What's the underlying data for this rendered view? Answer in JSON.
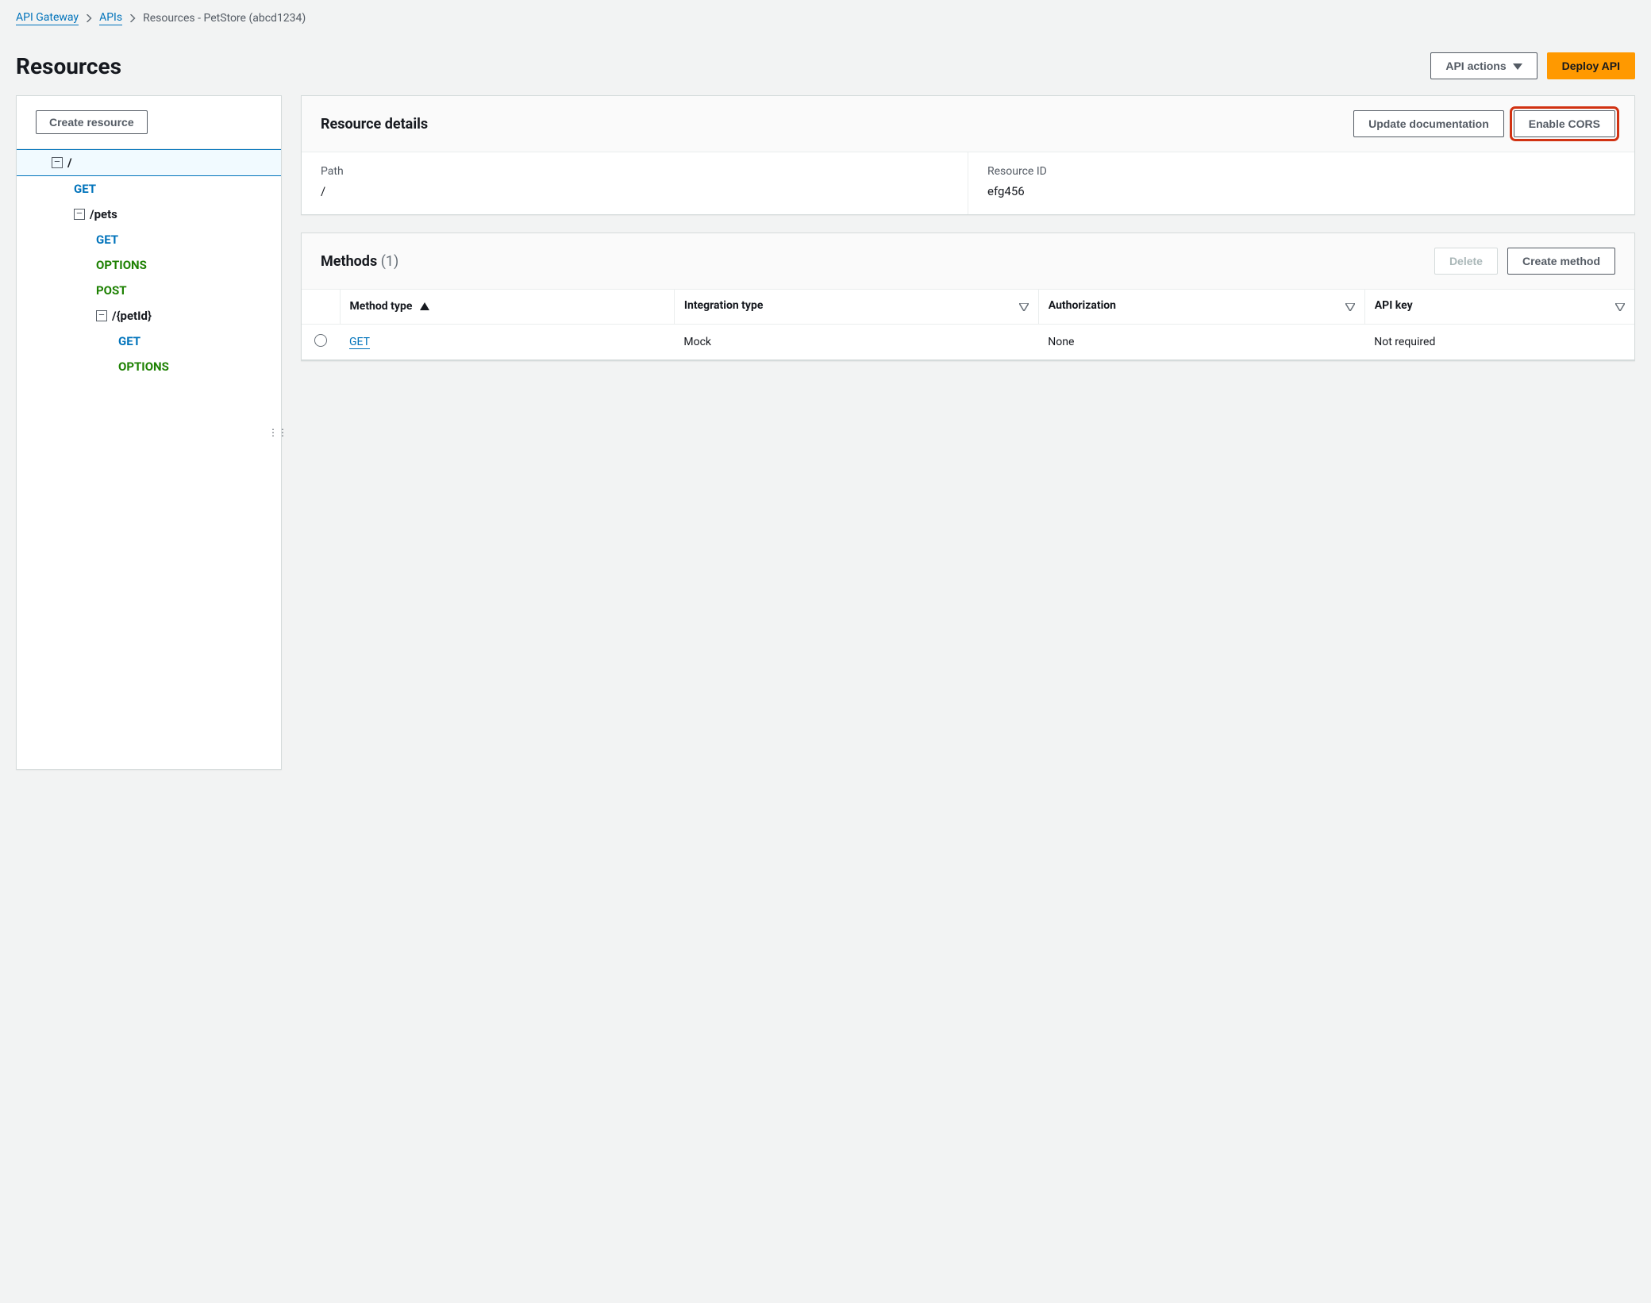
{
  "breadcrumb": {
    "items": [
      "API Gateway",
      "APIs"
    ],
    "current": "Resources - PetStore (abcd1234)"
  },
  "header": {
    "title": "Resources",
    "api_actions_label": "API actions",
    "deploy_label": "Deploy API"
  },
  "sidebar": {
    "create_resource_label": "Create resource",
    "tree": {
      "root": "/",
      "root_get": "GET",
      "pets": "/pets",
      "pets_get": "GET",
      "pets_options": "OPTIONS",
      "pets_post": "POST",
      "petid": "/{petId}",
      "petid_get": "GET",
      "petid_options": "OPTIONS"
    }
  },
  "resource_details": {
    "heading": "Resource details",
    "update_docs_label": "Update documentation",
    "enable_cors_label": "Enable CORS",
    "path_label": "Path",
    "path_value": "/",
    "resource_id_label": "Resource ID",
    "resource_id_value": "efg456"
  },
  "methods": {
    "heading": "Methods",
    "count": "(1)",
    "delete_label": "Delete",
    "create_method_label": "Create method",
    "columns": {
      "method_type": "Method type",
      "integration_type": "Integration type",
      "authorization": "Authorization",
      "api_key": "API key"
    },
    "rows": [
      {
        "method": "GET",
        "integration": "Mock",
        "authorization": "None",
        "api_key": "Not required"
      }
    ]
  }
}
